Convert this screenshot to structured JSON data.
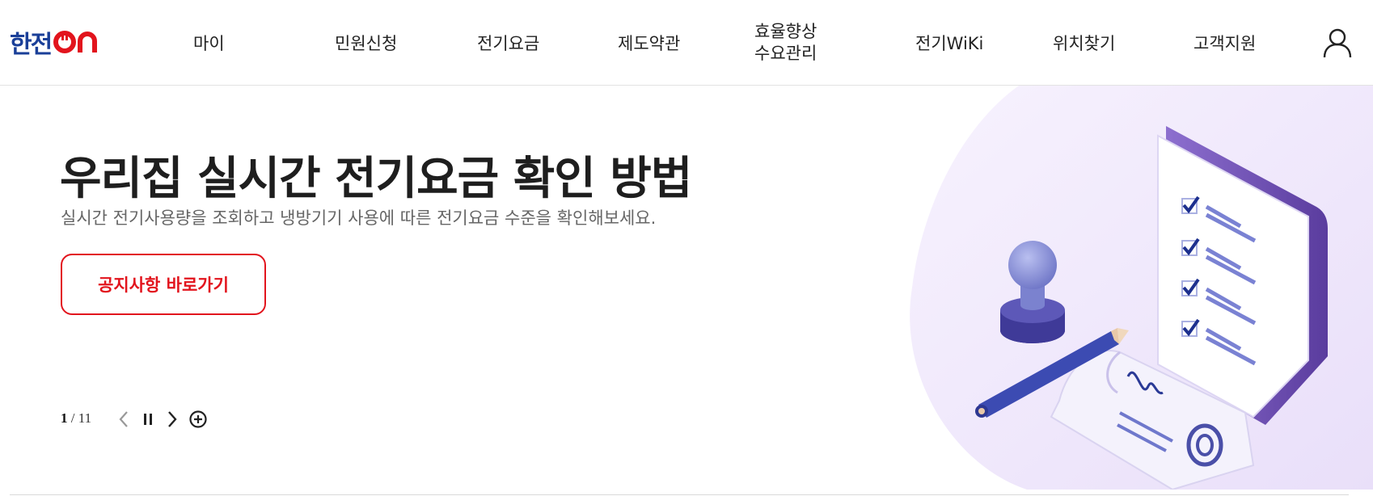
{
  "header": {
    "logo": {
      "main": "한전",
      "on": "ON"
    },
    "nav": [
      {
        "label": "마이"
      },
      {
        "label": "민원신청"
      },
      {
        "label": "전기요금"
      },
      {
        "label": "제도약관"
      },
      {
        "label": "효율향상",
        "label2": "수요관리"
      },
      {
        "label": "전기WiKi"
      },
      {
        "label": "위치찾기"
      },
      {
        "label": "고객지원"
      }
    ],
    "user_icon": "user-icon"
  },
  "hero": {
    "title": "우리집 실시간 전기요금 확인 방법",
    "subtitle": "실시간 전기사용량을 조회하고 냉방기기 사용에 따른 전기요금 수준을 확인해보세요.",
    "cta_label": "공지사항 바로가기"
  },
  "slider": {
    "current": "1",
    "separator": "/",
    "total": "11",
    "icons": [
      "chevron-left-icon",
      "pause-icon",
      "chevron-right-icon",
      "plus-circle-icon"
    ]
  },
  "colors": {
    "brand_blue": "#1a3f98",
    "brand_red": "#e2141d",
    "illustration_bg": "#f0eafc",
    "illustration_purple": "#6a4fb0"
  }
}
